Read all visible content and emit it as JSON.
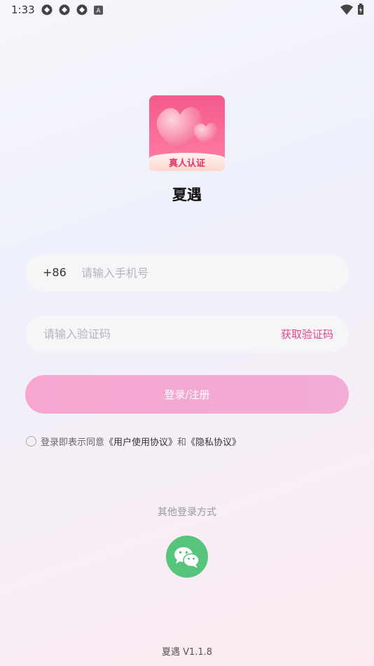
{
  "status_bar": {
    "time": "1:33",
    "left_icons": [
      "sync-icon",
      "sync-icon",
      "sync-icon",
      "app-icon"
    ],
    "right_icons": [
      "wifi-icon",
      "battery-icon"
    ]
  },
  "app": {
    "logo_badge": "真人认证",
    "name": "夏遇",
    "logo_colors": [
      "#f45a8c",
      "#ff7fa5"
    ]
  },
  "phone": {
    "prefix": "+86",
    "placeholder": "请输入手机号",
    "value": ""
  },
  "code": {
    "placeholder": "请输入验证码",
    "value": "",
    "get_code_label": "获取验证码"
  },
  "login_button": {
    "label": "登录/注册"
  },
  "agreement": {
    "checked": false,
    "prefix": "登录即表示同意",
    "user_agreement": "《用户使用协议》",
    "and": "和",
    "privacy": "《隐私协议》"
  },
  "other_login": {
    "label": "其他登录方式",
    "wechat_color": "#56c47b"
  },
  "version": "夏遇 V1.1.8",
  "colors": {
    "accent": "#e0458a",
    "button": "#f4a9d2"
  }
}
